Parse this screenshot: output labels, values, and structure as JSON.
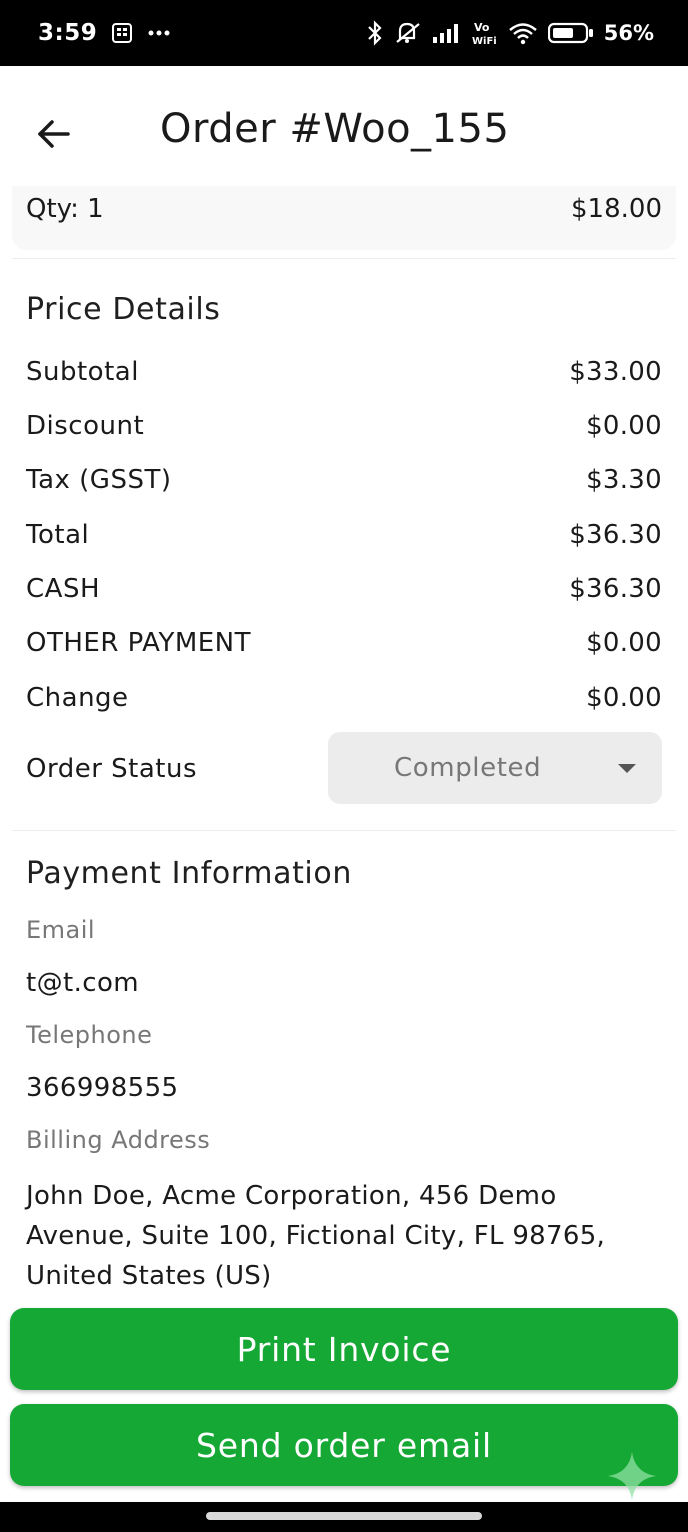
{
  "status_bar": {
    "time": "3:59",
    "battery_percent": "56%",
    "network_label": "Vo WiFi",
    "icons": [
      "sim-icon",
      "more-dots-icon",
      "bluetooth-icon",
      "mute-icon",
      "signal-icon",
      "vowifi-icon",
      "wifi-icon",
      "battery-icon"
    ]
  },
  "header": {
    "title": "Order #Woo_155",
    "back_icon": "back-arrow-icon"
  },
  "item": {
    "qty": "Qty: 1",
    "price": "$18.00"
  },
  "price_details": {
    "title": "Price Details",
    "rows": [
      {
        "label": "Subtotal",
        "value": "$33.00"
      },
      {
        "label": "Discount",
        "value": "$0.00"
      },
      {
        "label": "Tax (GSST)",
        "value": "$3.30"
      },
      {
        "label": "Total",
        "value": "$36.30"
      },
      {
        "label": "CASH",
        "value": "$36.30"
      },
      {
        "label": "OTHER PAYMENT",
        "value": "$0.00"
      },
      {
        "label": "Change",
        "value": "$0.00"
      }
    ],
    "order_status_label": "Order Status",
    "order_status_value": "Completed"
  },
  "payment_info": {
    "title": "Payment Information",
    "email_label": "Email",
    "email": "t@t.com",
    "telephone_label": "Telephone",
    "telephone": "366998555",
    "billing_label": "Billing Address",
    "billing_address": "John Doe, Acme Corporation, 456 Demo Avenue, Suite 100, Fictional City, FL 98765, United States (US)"
  },
  "actions": {
    "print_invoice": "Print Invoice",
    "send_email": "Send order email"
  },
  "colors": {
    "accent_green": "#16a834",
    "select_bg": "#ececec",
    "muted_text": "#777777"
  }
}
